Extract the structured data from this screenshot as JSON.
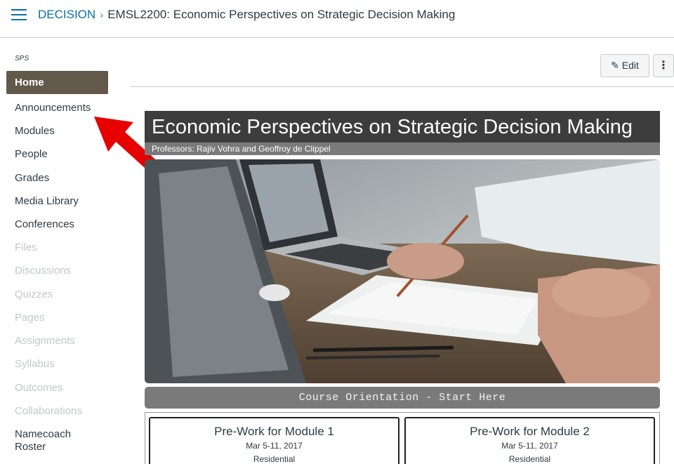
{
  "breadcrumb": {
    "course_code": "DECISION",
    "separator": "›",
    "current": "EMSL2200: Economic Perspectives on Strategic Decision Making"
  },
  "sidebar": {
    "sub_account": "SPS",
    "home": "Home",
    "items": [
      {
        "label": "Announcements",
        "enabled": true
      },
      {
        "label": "Modules",
        "enabled": true
      },
      {
        "label": "People",
        "enabled": true
      },
      {
        "label": "Grades",
        "enabled": true
      },
      {
        "label": "Media Library",
        "enabled": true
      },
      {
        "label": "Conferences",
        "enabled": true
      },
      {
        "label": "Files",
        "enabled": false
      },
      {
        "label": "Discussions",
        "enabled": false
      },
      {
        "label": "Quizzes",
        "enabled": false
      },
      {
        "label": "Pages",
        "enabled": false
      },
      {
        "label": "Assignments",
        "enabled": false
      },
      {
        "label": "Syllabus",
        "enabled": false
      },
      {
        "label": "Outcomes",
        "enabled": false
      },
      {
        "label": "Collaborations",
        "enabled": false
      },
      {
        "label": "Namecoach",
        "enabled": true
      },
      {
        "label": "Roster",
        "enabled": true
      }
    ]
  },
  "toolbar": {
    "edit_label": "Edit",
    "edit_icon": "pencil-icon",
    "more_label": "⋮"
  },
  "banner": {
    "title": "Economic Perspectives on Strategic Decision Making",
    "professors": "Professors: Rajiv Vohra and Geoffroy de Clippel"
  },
  "orientation": {
    "label": "Course Orientation - Start Here"
  },
  "modules": [
    {
      "title": "Pre-Work for Module 1",
      "dates": "Mar 5-11, 2017",
      "type": "Residential"
    },
    {
      "title": "Pre-Work for Module 2",
      "dates": "Mar 5-11, 2017",
      "type": "Residential"
    }
  ],
  "colors": {
    "link": "#0770a3",
    "home_active": "#62594a",
    "annotation_arrow": "#e60000",
    "banner_bg": "#3d3d3d",
    "gray_bar": "#7a7a7a"
  }
}
